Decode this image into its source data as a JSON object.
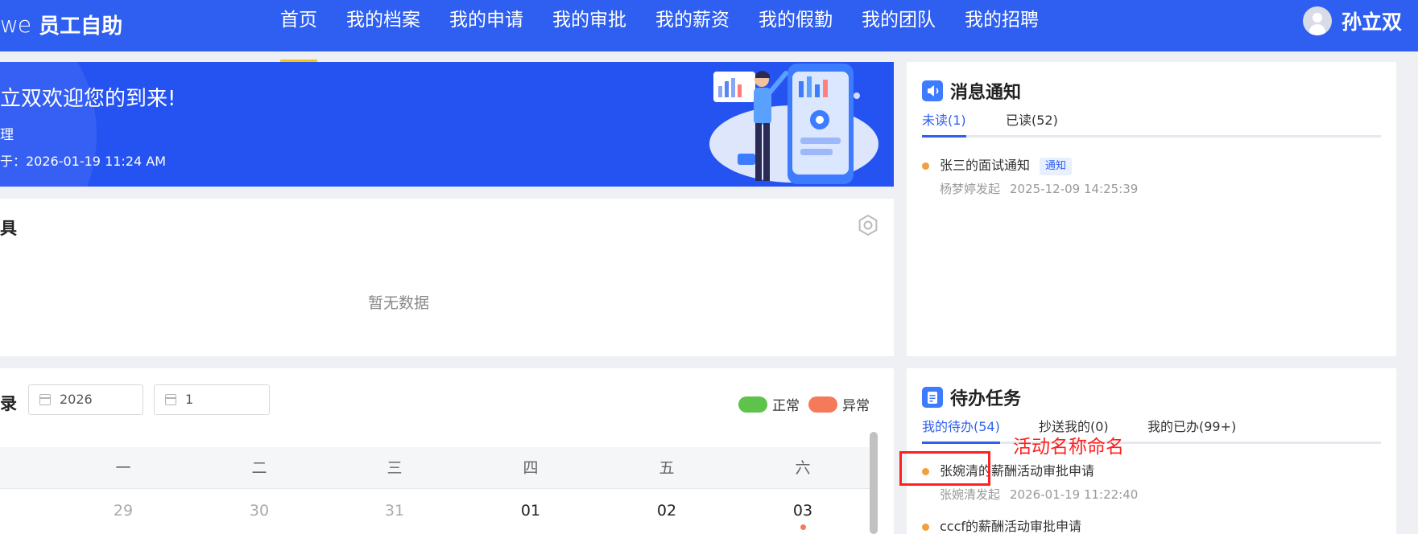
{
  "header": {
    "logo_mark": "we",
    "logo_text": "员工自助",
    "nav": [
      {
        "label": "首页",
        "active": true
      },
      {
        "label": "我的档案"
      },
      {
        "label": "我的申请"
      },
      {
        "label": "我的审批"
      },
      {
        "label": "我的薪资"
      },
      {
        "label": "我的假勤"
      },
      {
        "label": "我的团队"
      },
      {
        "label": "我的招聘"
      }
    ],
    "user_name": "孙立双"
  },
  "banner": {
    "welcome": "立双欢迎您的到来!",
    "role": "理",
    "login_time": "于：2026-01-19 11:24 AM"
  },
  "tools": {
    "title": "具",
    "empty_text": "暂无数据"
  },
  "attendance": {
    "title": "录",
    "year": "2026",
    "month": "1",
    "legend_normal": "正常",
    "legend_abnormal": "异常",
    "colors": {
      "normal": "#5ec34a",
      "abnormal": "#f47a5a"
    },
    "weekdays": [
      "一",
      "二",
      "三",
      "四",
      "五",
      "六"
    ],
    "days": [
      {
        "label": "29",
        "muted": true
      },
      {
        "label": "30",
        "muted": true
      },
      {
        "label": "31",
        "muted": true
      },
      {
        "label": "01",
        "muted": false
      },
      {
        "label": "02",
        "muted": false
      },
      {
        "label": "03",
        "muted": false,
        "mark": "abnormal"
      }
    ]
  },
  "notice": {
    "title": "消息通知",
    "tabs": [
      "未读(1)",
      "已读(52)"
    ],
    "items": [
      {
        "title": "张三的面试通知",
        "badge": "通知",
        "initiator": "杨梦婷发起",
        "time": "2025-12-09 14:25:39"
      }
    ]
  },
  "todo": {
    "title": "待办任务",
    "tabs": [
      "我的待办(54)",
      "抄送我的(0)",
      "我的已办(99+)"
    ],
    "items": [
      {
        "title": "张婉清的薪酬活动审批申请",
        "initiator": "张婉清发起",
        "time": "2026-01-19 11:22:40"
      },
      {
        "title": "cccf的薪酬活动审批申请"
      }
    ]
  },
  "annotation": {
    "text": "活动名称命名"
  }
}
